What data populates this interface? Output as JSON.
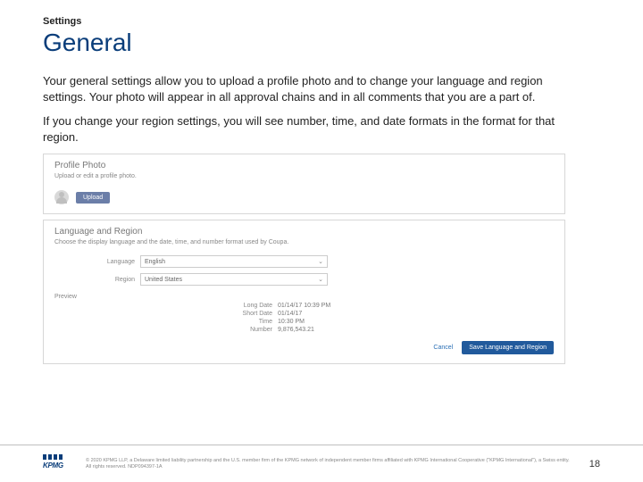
{
  "eyebrow": "Settings",
  "heading": "General",
  "paragraphs": [
    "Your general settings allow you to upload a profile photo and to change your language and region settings. Your photo will appear in all approval chains and in all comments that you are a part of.",
    "If you change your region settings, you will see number, time, and date formats in the format for that region."
  ],
  "profilePanel": {
    "title": "Profile Photo",
    "subtitle": "Upload or edit a profile photo.",
    "uploadLabel": "Upload"
  },
  "langPanel": {
    "title": "Language and Region",
    "subtitle": "Choose the display language and the date, time, and number format used by Coupa.",
    "languageLabel": "Language",
    "languageValue": "English",
    "regionLabel": "Region",
    "regionValue": "United States",
    "previewHeader": "Preview",
    "previews": [
      {
        "label": "Long Date",
        "value": "01/14/17 10:39 PM"
      },
      {
        "label": "Short Date",
        "value": "01/14/17"
      },
      {
        "label": "Time",
        "value": "10:30 PM"
      },
      {
        "label": "Number",
        "value": "9,876,543.21"
      }
    ],
    "cancel": "Cancel",
    "save": "Save Language and Region"
  },
  "footer": {
    "logoText": "KPMG",
    "fineprint": "© 2020 KPMG LLP, a Delaware limited liability partnership and the U.S. member firm of the KPMG network of independent member firms affiliated with KPMG International Cooperative (\"KPMG International\"), a Swiss entity. All rights reserved. NDP094397-1A",
    "page": "18"
  }
}
